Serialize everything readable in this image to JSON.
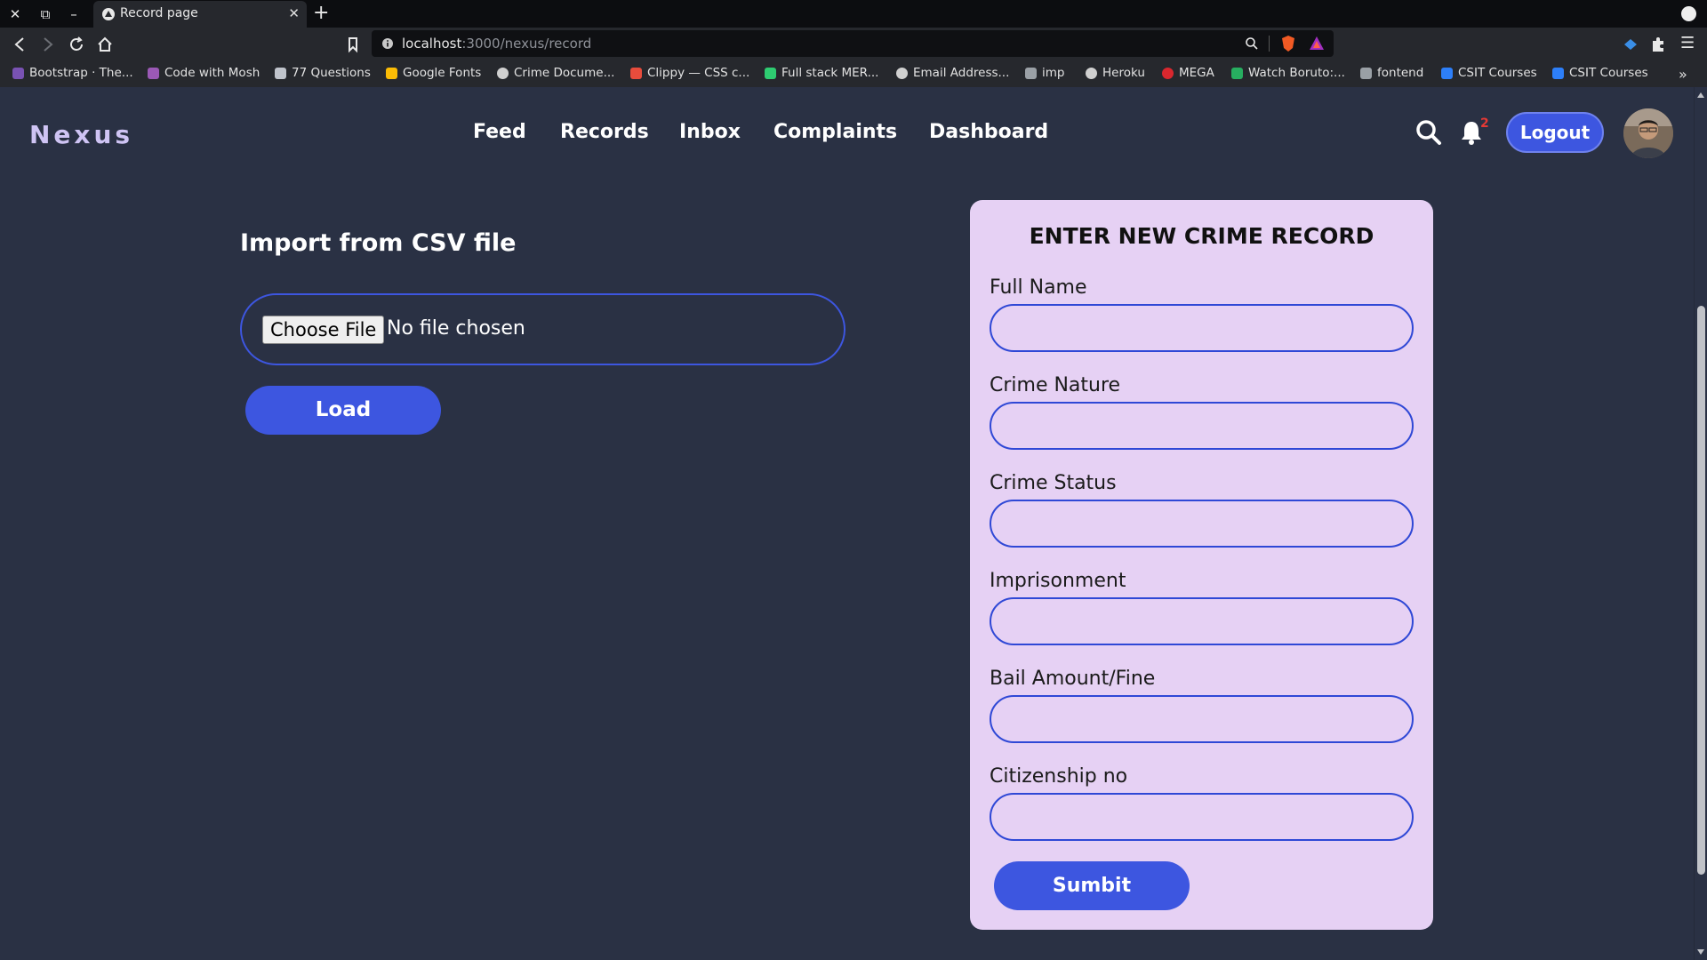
{
  "browser": {
    "tab_title": "Record page",
    "url_host": "localhost",
    "url_path": ":3000/nexus/record",
    "bookmarks": [
      {
        "label": "Bootstrap · The...",
        "color": "#7952b3"
      },
      {
        "label": "Code with Mosh",
        "color": "#9b59b6"
      },
      {
        "label": "77 Questions",
        "color": "#c0c4cc"
      },
      {
        "label": "Google Fonts",
        "color": "#fbbc05"
      },
      {
        "label": "Crime Docume...",
        "color": "#d0d0d0"
      },
      {
        "label": "Clippy — CSS c...",
        "color": "#e74c3c"
      },
      {
        "label": "Full stack MER...",
        "color": "#2ecc71"
      },
      {
        "label": "Email Address...",
        "color": "#d0d0d0"
      },
      {
        "label": "imp",
        "color": "#9aa0a6"
      },
      {
        "label": "Heroku",
        "color": "#d0d0d0"
      },
      {
        "label": "MEGA",
        "color": "#d9272e"
      },
      {
        "label": "Watch Boruto:...",
        "color": "#27ae60"
      },
      {
        "label": "fontend",
        "color": "#9aa0a6"
      },
      {
        "label": "CSIT Courses",
        "color": "#2d7ff9"
      },
      {
        "label": "CSIT Courses",
        "color": "#2d7ff9"
      }
    ],
    "bookmarks_overflow": "»"
  },
  "nav": {
    "brand": "Nexus",
    "links": [
      "Feed",
      "Records",
      "Inbox",
      "Complaints",
      "Dashboard"
    ],
    "notification_count": "2",
    "logout_label": "Logout"
  },
  "csv": {
    "title": "Import from CSV file",
    "choose_label": "Choose File",
    "no_file_label": "No file chosen",
    "load_label": "Load"
  },
  "form": {
    "title": "ENTER NEW CRIME RECORD",
    "fields": [
      {
        "label": "Full Name",
        "value": ""
      },
      {
        "label": "Crime Nature",
        "value": ""
      },
      {
        "label": "Crime Status",
        "value": ""
      },
      {
        "label": "Imprisonment",
        "value": ""
      },
      {
        "label": "Bail Amount/Fine",
        "value": ""
      },
      {
        "label": "Citizenship no",
        "value": ""
      }
    ],
    "submit_label": "Sumbit"
  },
  "colors": {
    "page_bg": "#2a3144",
    "accent": "#3d56e0",
    "card_bg": "#e6d1f4",
    "brand": "#cfc4f4"
  }
}
